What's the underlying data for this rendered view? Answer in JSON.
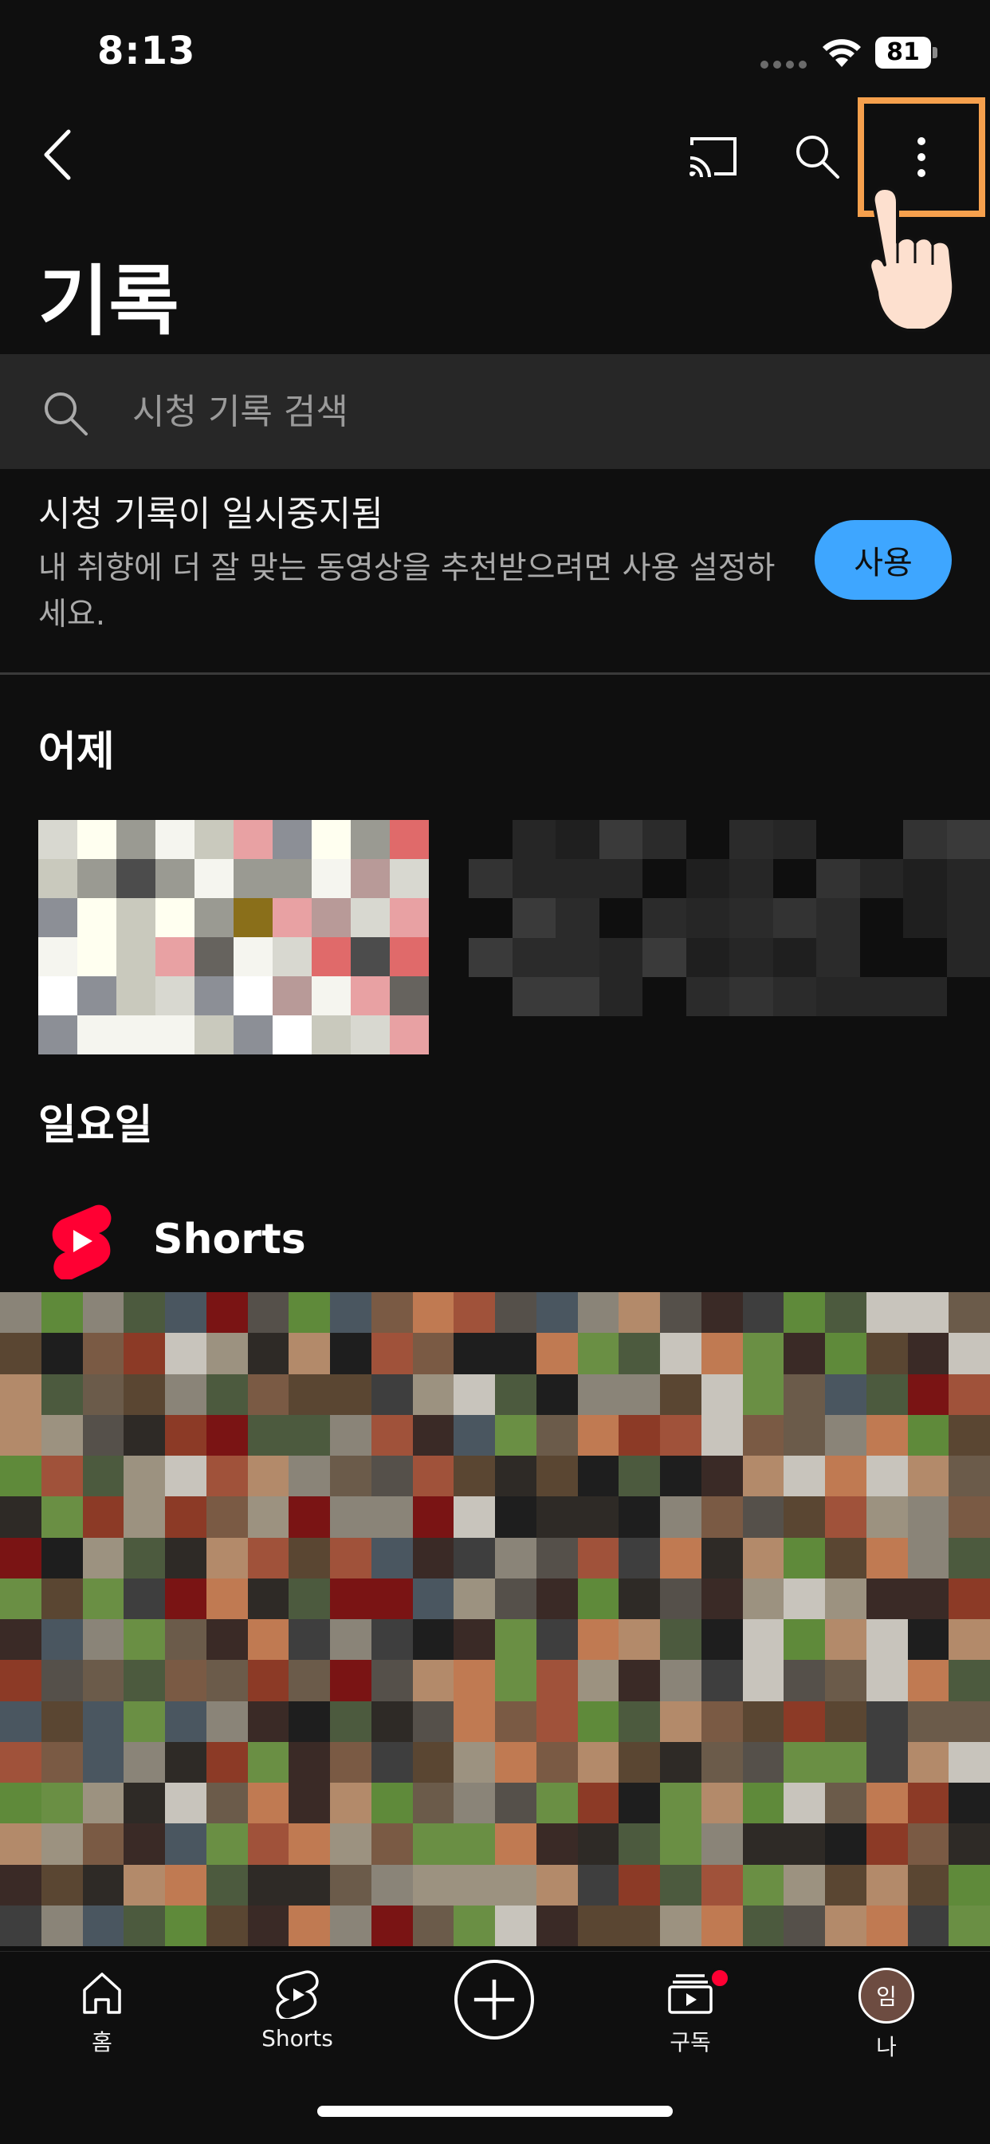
{
  "status_bar": {
    "time": "8:13",
    "battery": "81"
  },
  "top_bar": {
    "back_icon": "chevron-left-icon",
    "cast_icon": "cast-icon",
    "search_icon": "search-icon",
    "more_icon": "more-vertical-icon",
    "highlight_color": "#f6a04d"
  },
  "page": {
    "title": "기록"
  },
  "search": {
    "placeholder": "시청 기록 검색",
    "value": ""
  },
  "paused_banner": {
    "title": "시청 기록이 일시중지됨",
    "description": "내 취향에 더 잘 맞는 동영상을 추천받으려면 사용 설정하세요.",
    "button_label": "사용",
    "button_color": "#3ea6ff"
  },
  "sections": {
    "yesterday": {
      "heading": "어제"
    },
    "sunday": {
      "heading": "일요일"
    }
  },
  "shorts": {
    "label": "Shorts",
    "logo_color": "#ff0033"
  },
  "bottom_nav": {
    "home": "홈",
    "shorts": "Shorts",
    "subscriptions": "구독",
    "me": "나",
    "avatar_initial": "임",
    "notification_dot_color": "#ff0033"
  }
}
